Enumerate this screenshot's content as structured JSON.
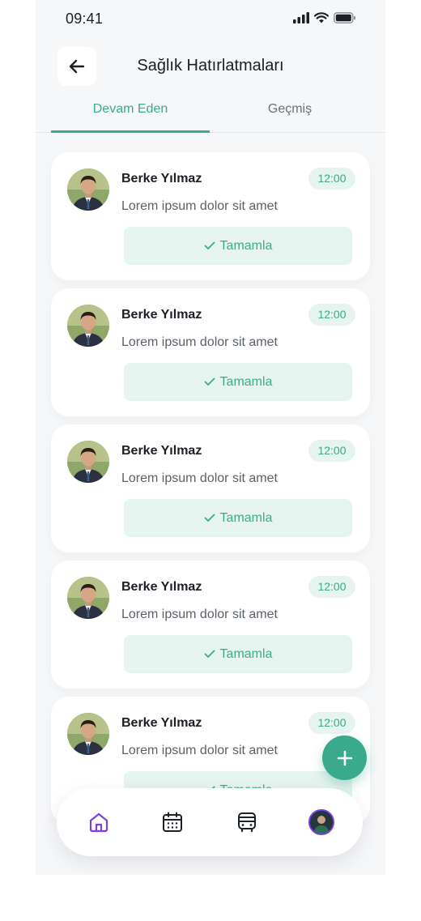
{
  "status_bar": {
    "time": "09:41"
  },
  "header": {
    "title": "Sağlık Hatırlatmaları",
    "back_icon": "arrow-left-icon"
  },
  "tabs": [
    {
      "label": "Devam Eden",
      "active": true
    },
    {
      "label": "Geçmiş",
      "active": false
    }
  ],
  "reminders": [
    {
      "name": "Berke Yılmaz",
      "time": "12:00",
      "description": "Lorem ipsum dolor sit amet",
      "action": "Tamamla"
    },
    {
      "name": "Berke Yılmaz",
      "time": "12:00",
      "description": "Lorem ipsum dolor sit amet",
      "action": "Tamamla"
    },
    {
      "name": "Berke Yılmaz",
      "time": "12:00",
      "description": "Lorem ipsum dolor sit amet",
      "action": "Tamamla"
    },
    {
      "name": "Berke Yılmaz",
      "time": "12:00",
      "description": "Lorem ipsum dolor sit amet",
      "action": "Tamamla"
    },
    {
      "name": "Berke Yılmaz",
      "time": "12:00",
      "description": "Lorem ipsum dolor sit amet",
      "action": "Tamamla"
    }
  ],
  "fab": {
    "icon": "plus-icon"
  },
  "bottom_nav": {
    "items": [
      {
        "icon": "home-icon",
        "active": true
      },
      {
        "icon": "calendar-icon",
        "active": false
      },
      {
        "icon": "bus-icon",
        "active": false
      },
      {
        "icon": "profile-avatar",
        "active": false
      }
    ]
  },
  "colors": {
    "accent": "#3aaa8d",
    "accent_light": "#e6f4ef",
    "nav_active": "#7b3fe4",
    "text": "#1b1f26"
  }
}
